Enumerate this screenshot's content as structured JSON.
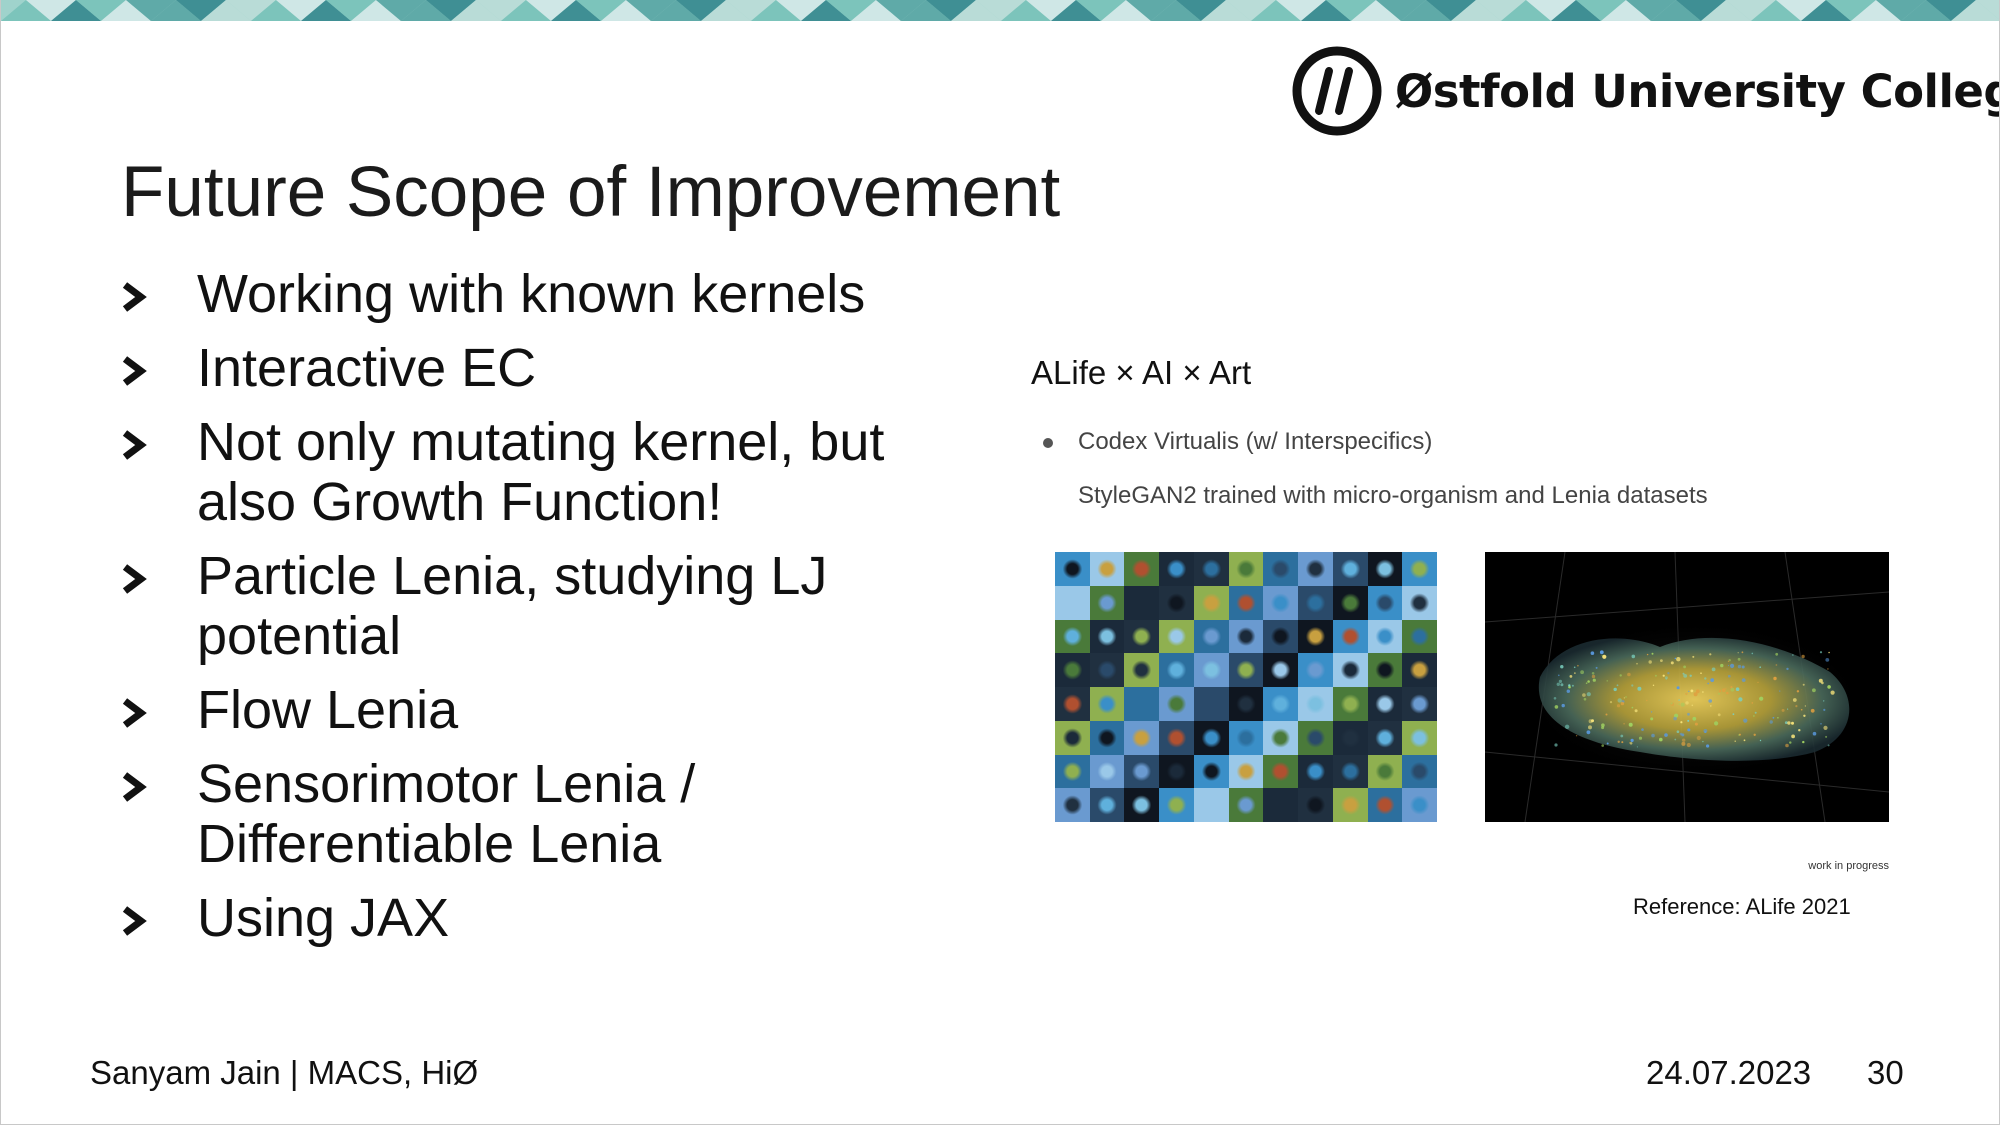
{
  "header": {
    "logo_text": "Østfold University College",
    "logo_icon": "hiof-logo-icon"
  },
  "slide": {
    "title": "Future Scope of Improvement",
    "bullets": [
      {
        "line1": "Working with known kernels",
        "line2": ""
      },
      {
        "line1": "Interactive EC",
        "line2": ""
      },
      {
        "line1": "Not only mutating kernel, but",
        "line2": "also Growth Function!"
      },
      {
        "line1": "Particle Lenia, studying LJ",
        "line2": "potential"
      },
      {
        "line1": "Flow Lenia",
        "line2": ""
      },
      {
        "line1": "Sensorimotor Lenia /",
        "line2": "Differentiable Lenia"
      },
      {
        "line1": "Using JAX",
        "line2": ""
      }
    ],
    "bullet_icon": "chevron-right-icon"
  },
  "reference_panel": {
    "heading": "ALife × AI × Art",
    "bullet": "Codex Virtualis (w/ Interspecifics)",
    "subtext": "StyleGAN2 trained with micro-organism and Lenia datasets",
    "image1_description_icon": "micro-organism-grid-image",
    "image2_description_icon": "lenia-render-image",
    "wip_label": "work in progress",
    "reference": "Reference: ALife 2021"
  },
  "footer": {
    "author": "Sanyam Jain | MACS, HiØ",
    "date": "24.07.2023",
    "page": "30"
  },
  "colors": {
    "band_teal": "#7cc4bb",
    "band_dark": "#3f8f94",
    "band_light": "#cfe7e6",
    "text": "#111111",
    "subtext": "#444444"
  }
}
